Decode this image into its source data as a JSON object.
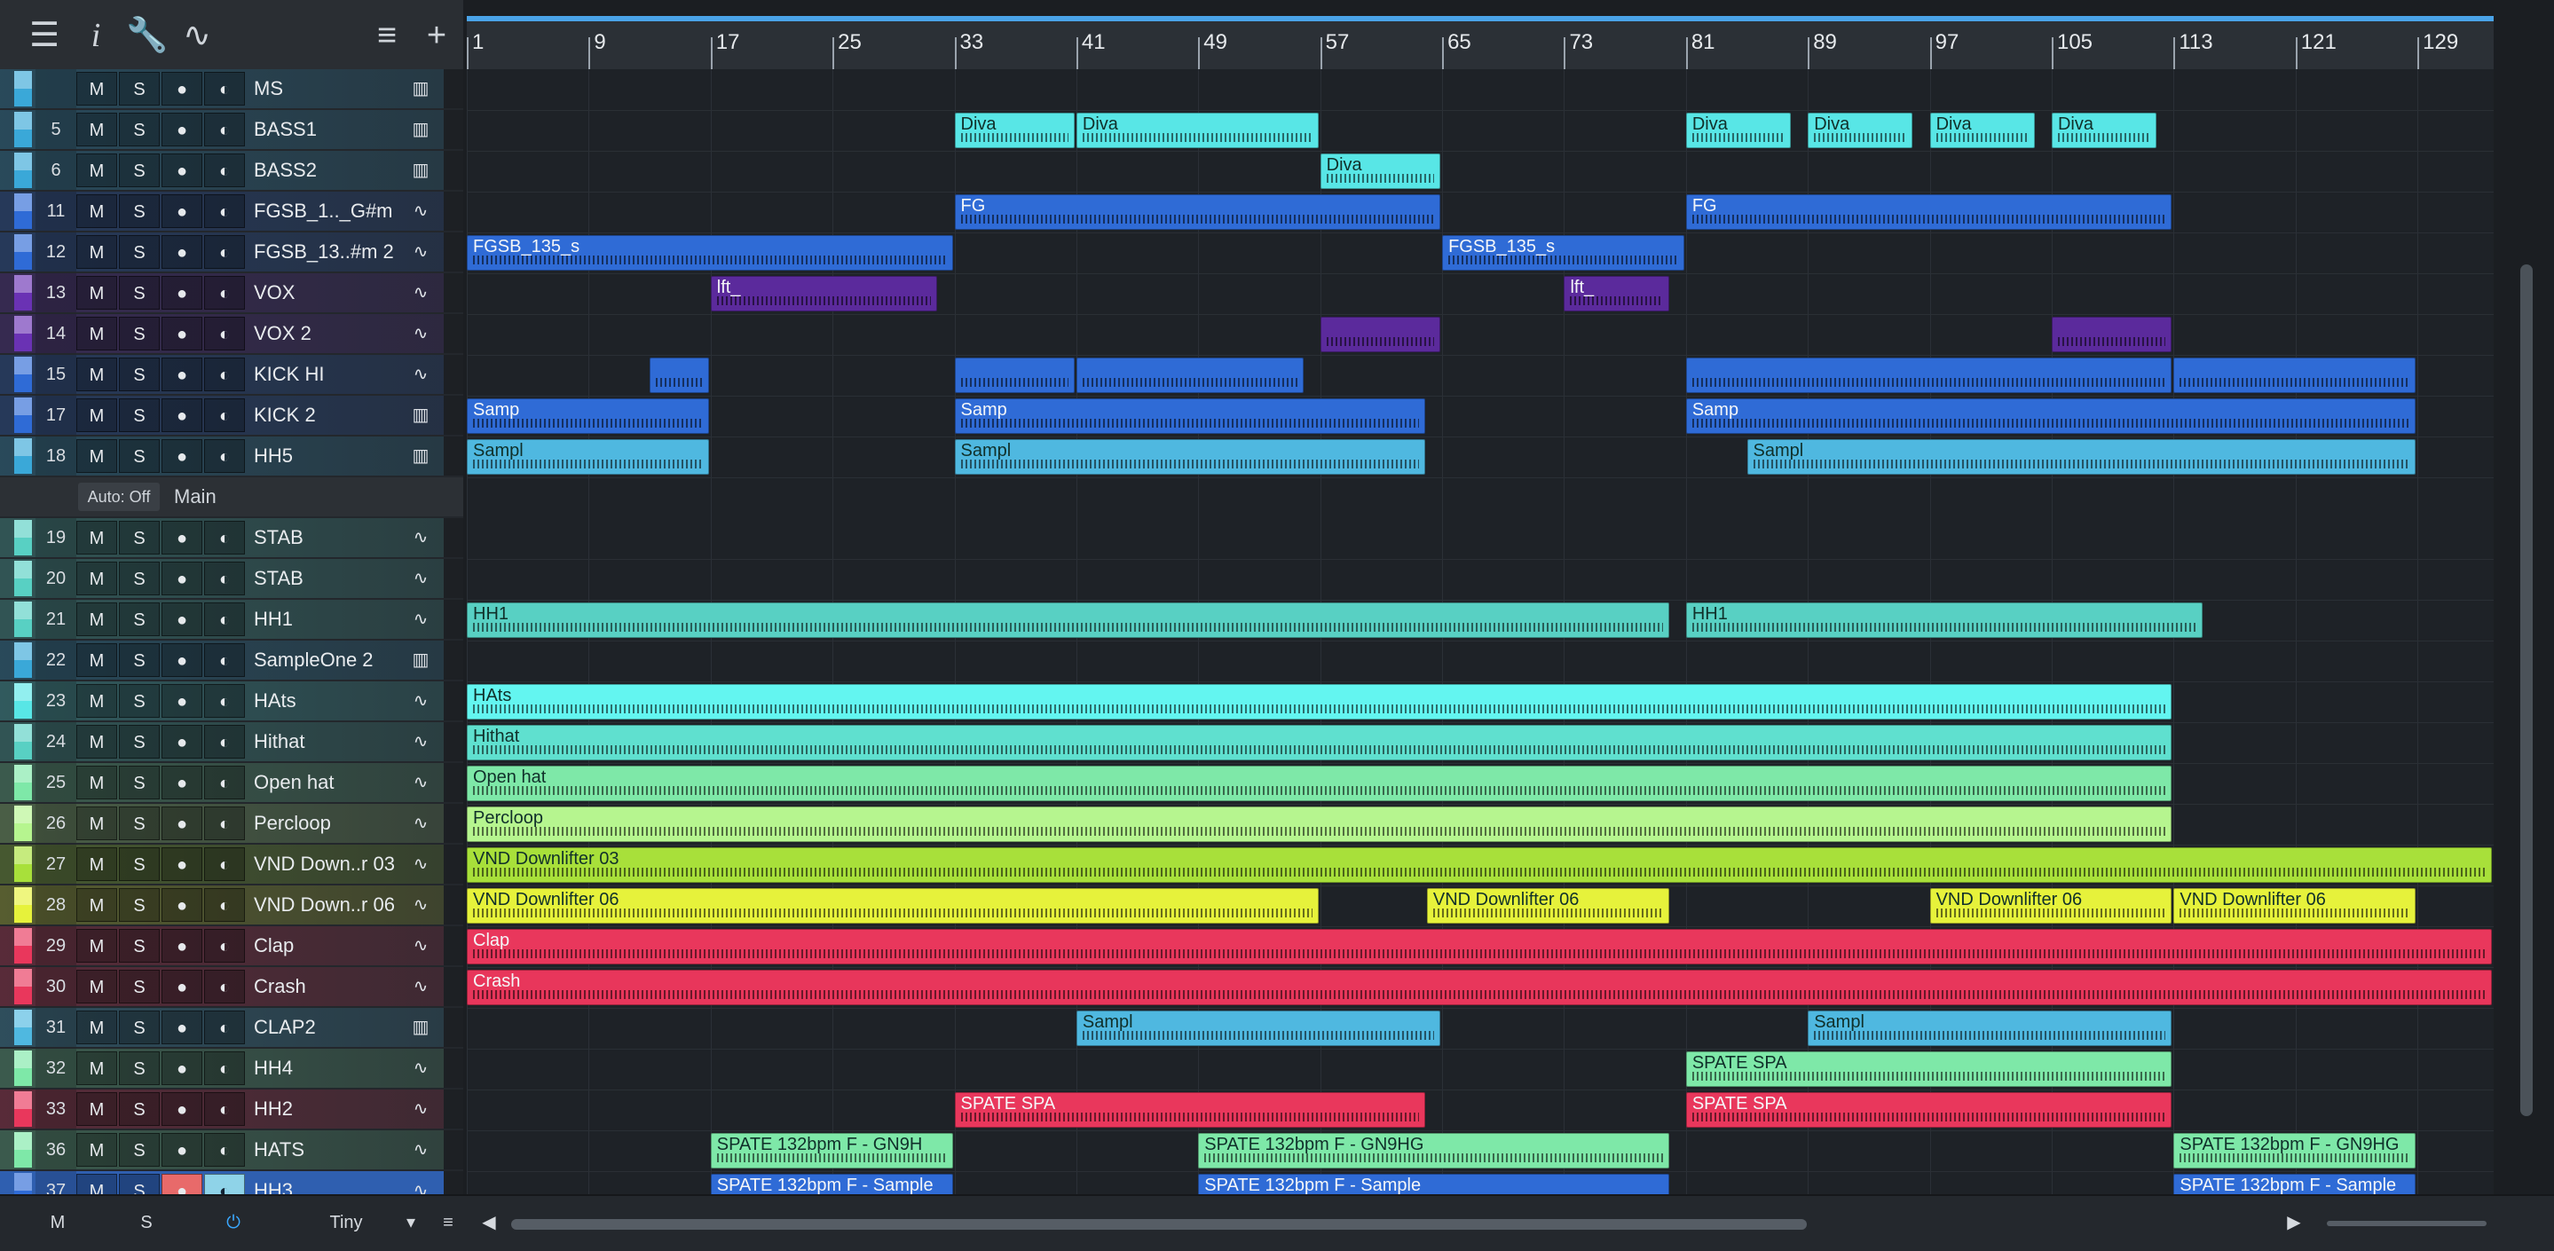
{
  "toolbar": {
    "icons": [
      "list-icon",
      "info-icon",
      "wrench-icon",
      "automation-icon",
      "hamburger-icon",
      "plus-icon"
    ]
  },
  "colors": {
    "teal": "#58d0c3",
    "blue": "#2f6bd6",
    "cyan": "#63f5f0",
    "green": "#7ee8a8",
    "lime": "#b6f58f",
    "yellow": "#e6f23b",
    "red": "#e9375c",
    "sky": "#4fb8e0",
    "purple": "#5b2a9c"
  },
  "ruler": {
    "bars": [
      "1",
      "9",
      "17",
      "25",
      "33",
      "41",
      "49",
      "57",
      "65",
      "73",
      "81",
      "89",
      "97",
      "105",
      "113",
      "121",
      "129"
    ]
  },
  "tracks": [
    {
      "num": "",
      "name": "MS",
      "color": "#3aa8d8",
      "icon": "piano-icon"
    },
    {
      "num": "5",
      "name": "BASS1",
      "color": "#3aa8d8",
      "icon": "piano-icon"
    },
    {
      "num": "6",
      "name": "BASS2",
      "color": "#3aa8d8",
      "icon": "piano-icon"
    },
    {
      "num": "11",
      "name": "FGSB_1.._G#m",
      "color": "#2f6bd6",
      "icon": "wave-icon"
    },
    {
      "num": "12",
      "name": "FGSB_13..#m 2",
      "color": "#2f6bd6",
      "icon": "wave-icon"
    },
    {
      "num": "13",
      "name": "VOX",
      "color": "#6a32b4",
      "icon": "wave-icon"
    },
    {
      "num": "14",
      "name": "VOX 2",
      "color": "#6a32b4",
      "icon": "wave-icon"
    },
    {
      "num": "15",
      "name": "KICK HI",
      "color": "#2f6bd6",
      "icon": "wave-icon"
    },
    {
      "num": "17",
      "name": "KICK 2",
      "color": "#2f6bd6",
      "icon": "piano-icon"
    },
    {
      "num": "18",
      "name": "HH5",
      "color": "#3aa8d8",
      "icon": "piano-icon"
    },
    {
      "num": "19",
      "name": "STAB",
      "color": "#58d0c3",
      "icon": "wave-icon"
    },
    {
      "num": "20",
      "name": "STAB",
      "color": "#58d0c3",
      "icon": "wave-icon"
    },
    {
      "num": "21",
      "name": "HH1",
      "color": "#58d0c3",
      "icon": "wave-icon"
    },
    {
      "num": "22",
      "name": "SampleOne 2",
      "color": "#3aa8d8",
      "icon": "piano-icon"
    },
    {
      "num": "23",
      "name": "HAts",
      "color": "#58e6e6",
      "icon": "wave-icon"
    },
    {
      "num": "24",
      "name": "Hithat",
      "color": "#58d0c3",
      "icon": "wave-icon"
    },
    {
      "num": "25",
      "name": "Open hat",
      "color": "#7ee8a8",
      "icon": "wave-icon"
    },
    {
      "num": "26",
      "name": "Percloop",
      "color": "#b6f58f",
      "icon": "wave-icon"
    },
    {
      "num": "27",
      "name": "VND Down..r 03",
      "color": "#a8e03a",
      "icon": "wave-icon"
    },
    {
      "num": "28",
      "name": "VND Down..r 06",
      "color": "#e6f23b",
      "icon": "wave-icon"
    },
    {
      "num": "29",
      "name": "Clap",
      "color": "#e9375c",
      "icon": "wave-icon"
    },
    {
      "num": "30",
      "name": "Crash",
      "color": "#e9375c",
      "icon": "wave-icon"
    },
    {
      "num": "31",
      "name": "CLAP2",
      "color": "#4fb8e0",
      "icon": "piano-icon"
    },
    {
      "num": "32",
      "name": "HH4",
      "color": "#7ee8a8",
      "icon": "wave-icon"
    },
    {
      "num": "33",
      "name": "HH2",
      "color": "#e9375c",
      "icon": "wave-icon"
    },
    {
      "num": "36",
      "name": "HATS",
      "color": "#7ee8a8",
      "icon": "wave-icon"
    },
    {
      "num": "37",
      "name": "HH3",
      "color": "#2f6bd6",
      "icon": "wave-icon"
    }
  ],
  "folder": {
    "auto_label": "Auto: Off",
    "name": "Main"
  },
  "track_buttons": {
    "mute": "M",
    "solo": "S",
    "record": "●",
    "monitor": "◐"
  },
  "clips": [
    {
      "lane": 1,
      "start": 33,
      "end": 41,
      "label": "Diva",
      "color": "#58e6e6"
    },
    {
      "lane": 1,
      "start": 41,
      "end": 57,
      "label": "Diva",
      "color": "#58e6e6"
    },
    {
      "lane": 1,
      "start": 81,
      "end": 88,
      "label": "Diva",
      "color": "#58e6e6"
    },
    {
      "lane": 1,
      "start": 89,
      "end": 96,
      "label": "Diva",
      "color": "#58e6e6"
    },
    {
      "lane": 1,
      "start": 97,
      "end": 104,
      "label": "Diva",
      "color": "#58e6e6"
    },
    {
      "lane": 1,
      "start": 105,
      "end": 112,
      "label": "Diva",
      "color": "#58e6e6"
    },
    {
      "lane": 2,
      "start": 57,
      "end": 65,
      "label": "Diva",
      "color": "#58e6e6"
    },
    {
      "lane": 3,
      "start": 33,
      "end": 65,
      "label": "FG",
      "color": "#2f6bd6"
    },
    {
      "lane": 3,
      "start": 81,
      "end": 113,
      "label": "FG",
      "color": "#2f6bd6"
    },
    {
      "lane": 4,
      "start": 1,
      "end": 33,
      "label": "FGSB_135_s",
      "color": "#2f6bd6"
    },
    {
      "lane": 4,
      "start": 65,
      "end": 81,
      "label": "FGSB_135_s",
      "color": "#2f6bd6"
    },
    {
      "lane": 5,
      "start": 17,
      "end": 32,
      "label": "lft_",
      "color": "#5b2a9c"
    },
    {
      "lane": 5,
      "start": 73,
      "end": 80,
      "label": "lft_",
      "color": "#5b2a9c"
    },
    {
      "lane": 6,
      "start": 57,
      "end": 65,
      "label": "",
      "color": "#5b2a9c"
    },
    {
      "lane": 6,
      "start": 105,
      "end": 113,
      "label": "",
      "color": "#5b2a9c"
    },
    {
      "lane": 7,
      "start": 13,
      "end": 17,
      "label": "",
      "color": "#2f6bd6"
    },
    {
      "lane": 7,
      "start": 33,
      "end": 41,
      "label": "",
      "color": "#2f6bd6"
    },
    {
      "lane": 7,
      "start": 41,
      "end": 56,
      "label": "",
      "color": "#2f6bd6"
    },
    {
      "lane": 7,
      "start": 81,
      "end": 113,
      "label": "",
      "color": "#2f6bd6"
    },
    {
      "lane": 7,
      "start": 113,
      "end": 129,
      "label": "",
      "color": "#2f6bd6"
    },
    {
      "lane": 8,
      "start": 1,
      "end": 17,
      "label": "Samp",
      "color": "#2f6bd6"
    },
    {
      "lane": 8,
      "start": 33,
      "end": 64,
      "label": "Samp",
      "color": "#2f6bd6"
    },
    {
      "lane": 8,
      "start": 81,
      "end": 129,
      "label": "Samp",
      "color": "#2f6bd6"
    },
    {
      "lane": 9,
      "start": 1,
      "end": 17,
      "label": "Sampl",
      "color": "#4fb8e0"
    },
    {
      "lane": 9,
      "start": 33,
      "end": 64,
      "label": "Sampl",
      "color": "#4fb8e0"
    },
    {
      "lane": 9,
      "start": 85,
      "end": 129,
      "label": "Sampl",
      "color": "#4fb8e0"
    },
    {
      "lane": 12,
      "start": 1,
      "end": 80,
      "label": "HH1",
      "color": "#58d0c3"
    },
    {
      "lane": 12,
      "start": 81,
      "end": 115,
      "label": "HH1",
      "color": "#58d0c3"
    },
    {
      "lane": 14,
      "start": 1,
      "end": 113,
      "label": "HAts",
      "color": "#63f5f0"
    },
    {
      "lane": 15,
      "start": 1,
      "end": 113,
      "label": "Hithat",
      "color": "#5fe0cf"
    },
    {
      "lane": 16,
      "start": 1,
      "end": 113,
      "label": "Open hat",
      "color": "#7ee8a8"
    },
    {
      "lane": 17,
      "start": 1,
      "end": 113,
      "label": "Percloop",
      "color": "#b6f58f"
    },
    {
      "lane": 18,
      "start": 1,
      "end": 134,
      "label": "VND Downlifter 03",
      "color": "#a8e03a"
    },
    {
      "lane": 19,
      "start": 1,
      "end": 57,
      "label": "VND Downlifter 06",
      "color": "#e6f23b"
    },
    {
      "lane": 19,
      "start": 64,
      "end": 80,
      "label": "VND Downlifter 06",
      "color": "#e6f23b"
    },
    {
      "lane": 19,
      "start": 97,
      "end": 113,
      "label": "VND Downlifter 06",
      "color": "#e6f23b"
    },
    {
      "lane": 19,
      "start": 113,
      "end": 129,
      "label": "VND Downlifter 06",
      "color": "#e6f23b"
    },
    {
      "lane": 20,
      "start": 1,
      "end": 134,
      "label": "Clap",
      "color": "#e9375c"
    },
    {
      "lane": 21,
      "start": 1,
      "end": 134,
      "label": "Crash",
      "color": "#e8365b"
    },
    {
      "lane": 22,
      "start": 41,
      "end": 65,
      "label": "Sampl",
      "color": "#4fb8e0"
    },
    {
      "lane": 22,
      "start": 89,
      "end": 113,
      "label": "Sampl",
      "color": "#4fb8e0"
    },
    {
      "lane": 23,
      "start": 81,
      "end": 113,
      "label": "SPATE SPA",
      "color": "#7ee8a8"
    },
    {
      "lane": 24,
      "start": 33,
      "end": 64,
      "label": "SPATE SPA",
      "color": "#e9375c"
    },
    {
      "lane": 24,
      "start": 81,
      "end": 113,
      "label": "SPATE SPA",
      "color": "#e9375c"
    },
    {
      "lane": 25,
      "start": 17,
      "end": 33,
      "label": "SPATE 132bpm F - GN9H",
      "color": "#7ee8a8"
    },
    {
      "lane": 25,
      "start": 49,
      "end": 80,
      "label": "SPATE 132bpm F - GN9HG",
      "color": "#7ee8a8"
    },
    {
      "lane": 25,
      "start": 113,
      "end": 129,
      "label": "SPATE 132bpm F - GN9HG",
      "color": "#7ee8a8"
    },
    {
      "lane": 26,
      "start": 17,
      "end": 33,
      "label": "SPATE 132bpm F - Sample",
      "color": "#2f6bd6"
    },
    {
      "lane": 26,
      "start": 49,
      "end": 80,
      "label": "SPATE 132bpm F - Sample",
      "color": "#2f6bd6"
    },
    {
      "lane": 26,
      "start": 113,
      "end": 129,
      "label": "SPATE 132bpm F - Sample",
      "color": "#2f6bd6"
    }
  ],
  "bottom": {
    "mute": "M",
    "solo": "S",
    "power": "⏻",
    "size": "Tiny"
  }
}
